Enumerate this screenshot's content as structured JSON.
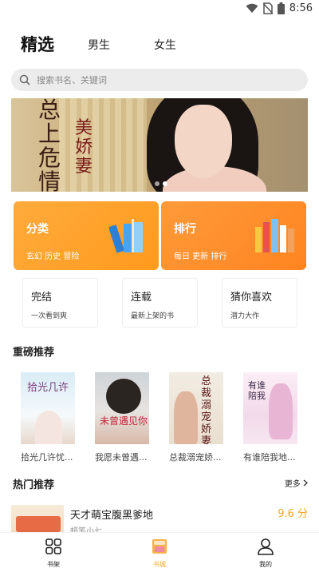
{
  "status": {
    "time": "8:56",
    "icons": [
      "wifi-icon",
      "no-sim-icon",
      "battery-icon"
    ]
  },
  "tabs": {
    "main": "精选",
    "male": "男生",
    "female": "女生"
  },
  "search": {
    "placeholder": "搜索书名、关键词"
  },
  "banner": {
    "title_a": "总上危情",
    "title_b": "美娇妻"
  },
  "category_cards": [
    {
      "title": "分类",
      "subtitle": "玄幻 历史 冒险"
    },
    {
      "title": "排行",
      "subtitle": "每日 更新 排行"
    }
  ],
  "small_cards": [
    {
      "title": "完结",
      "subtitle": "一次看到爽"
    },
    {
      "title": "连载",
      "subtitle": "最新上架的书"
    },
    {
      "title": "猜你喜欢",
      "subtitle": "潜力大作"
    }
  ],
  "featured": {
    "title": "重磅推荐",
    "books": [
      {
        "title": "拾光几许忧...",
        "cover_text": "拾光几许"
      },
      {
        "title": "我愿未曾遇...",
        "cover_text": "未曾遇见你"
      },
      {
        "title": "总裁溺宠娇...",
        "cover_text": "总裁溺宠娇妻"
      },
      {
        "title": "有谁陪我地...",
        "cover_text": "有谁陪我"
      }
    ]
  },
  "hot": {
    "title": "热门推荐",
    "more": "更多",
    "items": [
      {
        "title": "天才萌宝腹黑爹地",
        "score": "9.6 分",
        "author": "蜡笔小七"
      }
    ]
  },
  "bottom_nav": [
    {
      "label": "书架",
      "icon": "bookshelf-icon"
    },
    {
      "label": "书城",
      "icon": "bookstore-icon"
    },
    {
      "label": "我的",
      "icon": "profile-icon"
    }
  ],
  "colors": {
    "accent": "#f5a623",
    "card_orange": "#ff9a1d"
  }
}
